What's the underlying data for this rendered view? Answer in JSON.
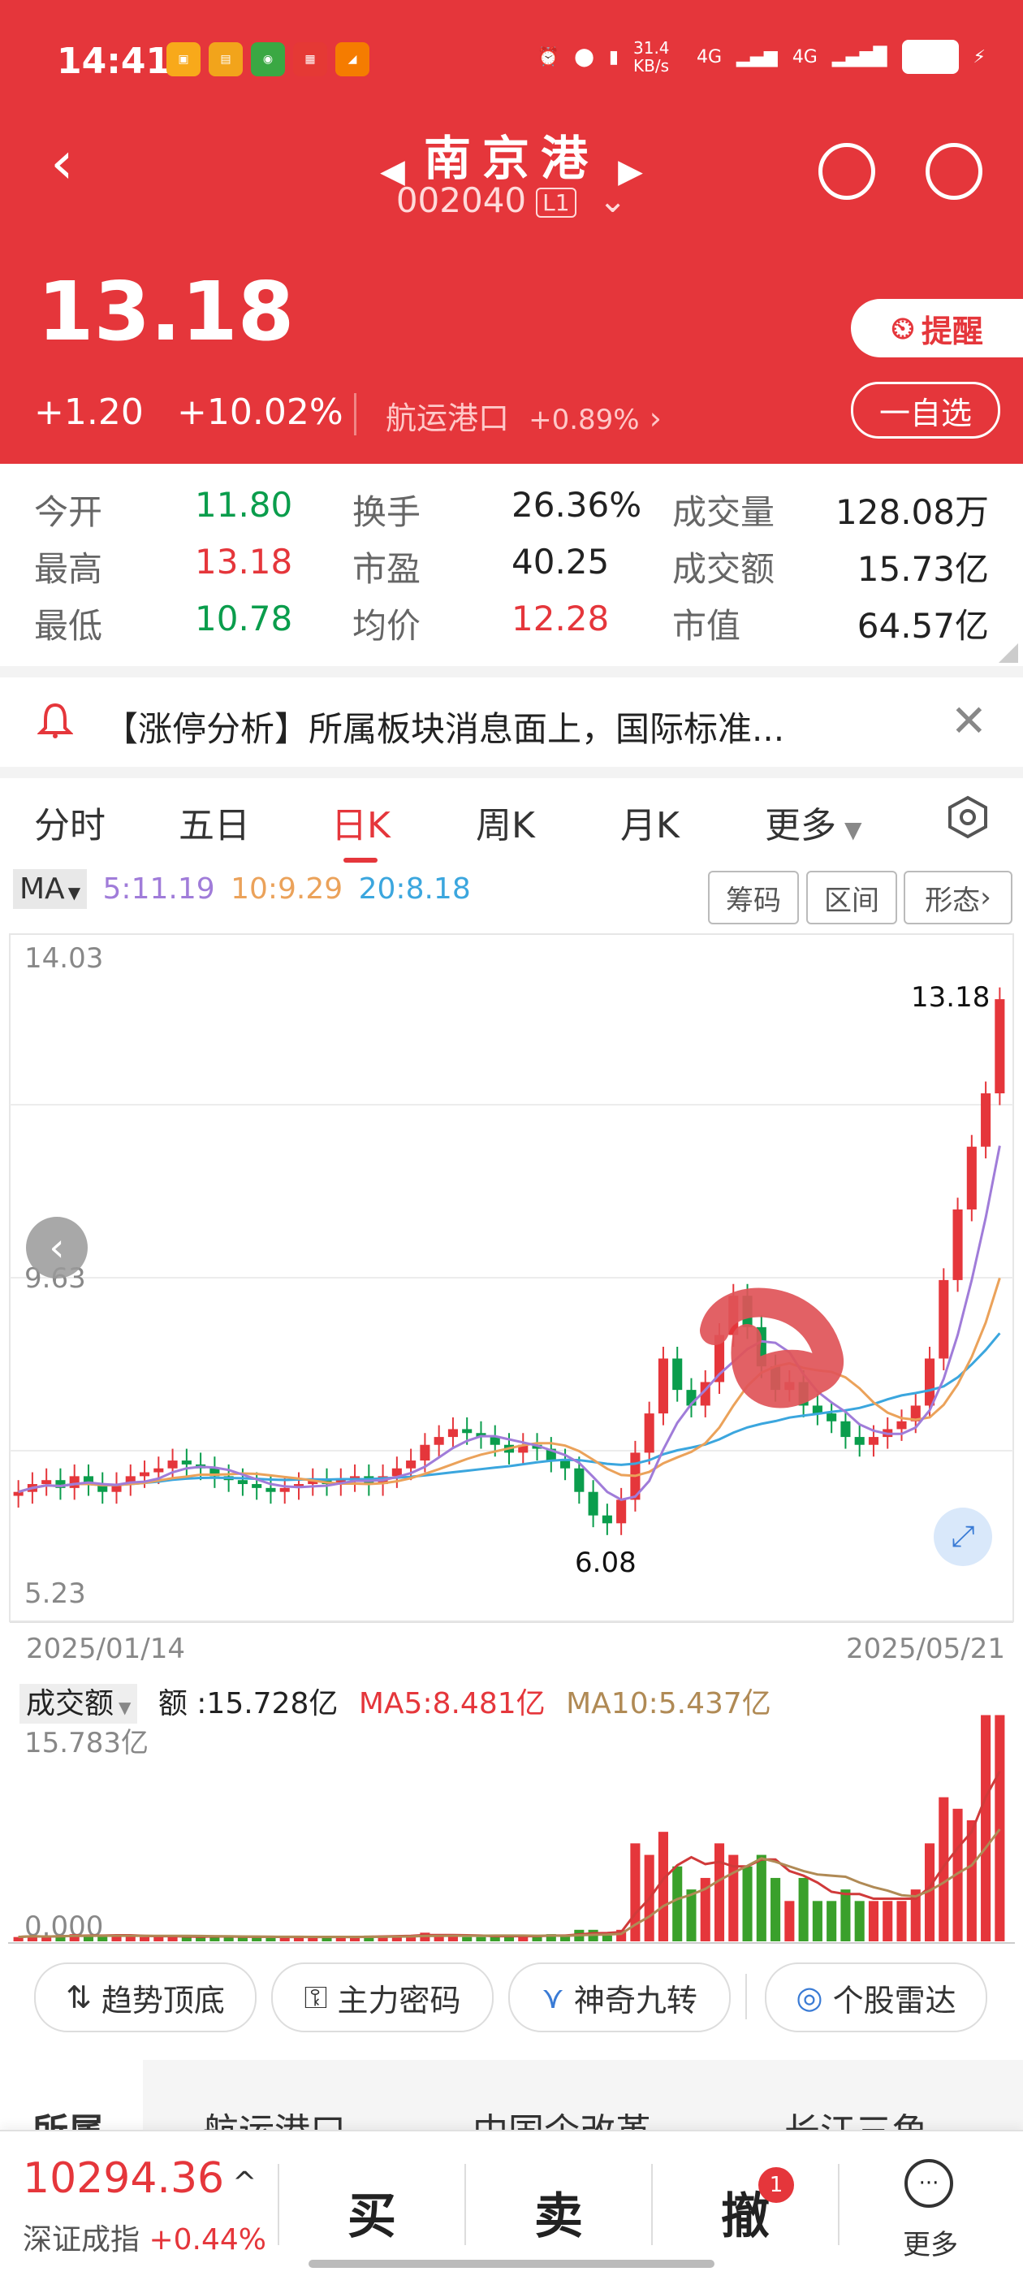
{
  "status_bar": {
    "time": "14:41",
    "net_speed": "31.4 KB/s",
    "net1": "4G",
    "net2": "4G"
  },
  "header": {
    "title": "南京港",
    "code": "002040",
    "level": "L1",
    "price": "13.18",
    "change": "+1.20",
    "change_pct": "+10.02%",
    "sector": "航运港口",
    "sector_pct": "+0.89%",
    "remind_label": "提醒",
    "fav_label": "一自选"
  },
  "stats": [
    {
      "label": "今开",
      "value": "11.80",
      "color": "green"
    },
    {
      "label": "换手",
      "value": "26.36%",
      "color": "black"
    },
    {
      "label": "成交量",
      "value": "128.08万",
      "color": "black"
    },
    {
      "label": "最高",
      "value": "13.18",
      "color": "red"
    },
    {
      "label": "市盈",
      "value": "40.25",
      "color": "black"
    },
    {
      "label": "成交额",
      "value": "15.73亿",
      "color": "black"
    },
    {
      "label": "最低",
      "value": "10.78",
      "color": "green"
    },
    {
      "label": "均价",
      "value": "12.28",
      "color": "red"
    },
    {
      "label": "市值",
      "value": "64.57亿",
      "color": "black"
    }
  ],
  "news": {
    "text": "【涨停分析】所属板块消息面上，国际标准..."
  },
  "tabs": [
    "分时",
    "五日",
    "日K",
    "周K",
    "月K",
    "更多"
  ],
  "active_tab": "日K",
  "ma": {
    "label": "MA",
    "ma5": "5:11.19",
    "ma10": "10:9.29",
    "ma20": "20:8.18"
  },
  "chart_buttons": [
    "筹码",
    "区间",
    "形态"
  ],
  "chart": {
    "y_max_label": "14.03",
    "y_mid_label": "9.63",
    "y_min_label": "5.23",
    "high_mark": "13.18",
    "low_mark": "6.08",
    "date_start": "2025/01/14",
    "date_end": "2025/05/21"
  },
  "volume": {
    "label": "成交额",
    "amount": "额 :15.728亿",
    "ma5": "MA5:8.481亿",
    "ma10": "MA10:5.437亿",
    "max_label": "15.783亿",
    "min_label": "0.000"
  },
  "tools": [
    "趋势顶底",
    "主力密码",
    "神奇九转",
    "个股雷达"
  ],
  "concepts": [
    "所属",
    "航运港口",
    "中国企改革",
    "长江三角"
  ],
  "bottom": {
    "index_value": "10294.36",
    "index_name": "深证成指",
    "index_pct": "+0.44%",
    "buy": "买",
    "sell": "卖",
    "cancel": "撤",
    "cancel_badge": "1",
    "more": "更多"
  },
  "colors": {
    "brand": "#e5363b",
    "up": "#e5363b",
    "down": "#0a9d4c"
  },
  "chart_data": {
    "type": "candlestick",
    "title": "",
    "x": [
      "2025/01/14",
      "2025/05/21"
    ],
    "ylim": [
      5.23,
      14.03
    ],
    "candles_close_approx": [
      6.9,
      7.0,
      7.05,
      6.95,
      7.1,
      7.0,
      6.9,
      7.0,
      7.1,
      7.15,
      7.2,
      7.3,
      7.25,
      7.2,
      7.1,
      7.05,
      7.0,
      6.95,
      6.9,
      6.95,
      7.0,
      7.05,
      7.0,
      7.05,
      7.1,
      7.0,
      7.1,
      7.2,
      7.3,
      7.5,
      7.6,
      7.7,
      7.65,
      7.6,
      7.5,
      7.4,
      7.5,
      7.45,
      7.3,
      7.2,
      6.9,
      6.6,
      6.5,
      6.8,
      7.4,
      7.9,
      8.6,
      8.2,
      8.0,
      8.3,
      8.9,
      9.4,
      9.0,
      8.5,
      8.2,
      8.3,
      8.0,
      7.9,
      7.8,
      7.6,
      7.5,
      7.6,
      7.7,
      7.8,
      8.0,
      8.6,
      9.6,
      10.5,
      11.3,
      11.98,
      13.18
    ],
    "volume_ylim": [
      0,
      15.783
    ],
    "volume_unit": "亿"
  }
}
